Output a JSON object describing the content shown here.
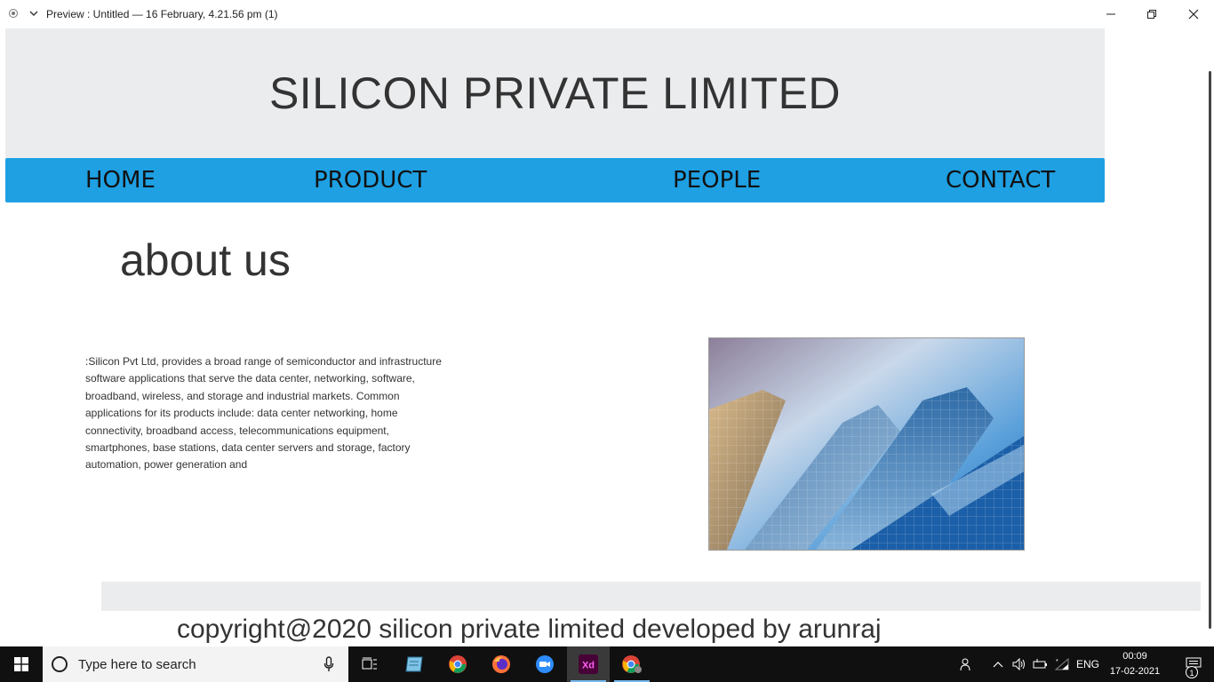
{
  "window": {
    "title": "Preview : Untitled — 16 February, 4.21.56 pm (1)"
  },
  "site": {
    "title": "SILICON PRIVATE LIMITED",
    "nav": [
      "HOME",
      "PRODUCT",
      "PEOPLE",
      "CONTACT"
    ],
    "about_heading": "about us",
    "about_text": ":Silicon Pvt Ltd, provides a broad range of semiconductor and infrastructure software applications that serve the data center, networking, software, broadband, wireless, and storage and industrial markets. Common applications for its products include: data center networking, home connectivity, broadband access, telecommunications equipment, smartphones, base stations, data center servers and storage, factory automation, power generation and",
    "copyright": "copyright@2020 silicon private limited developed by arunraj"
  },
  "taskbar": {
    "search_placeholder": "Type here to search",
    "language": "ENG",
    "time": "00:09",
    "date": "17-02-2021",
    "notification_count": "1"
  },
  "colors": {
    "nav_bar": "#1ea0e3",
    "header_bg": "#ebecee",
    "taskbar_bg": "#101010"
  },
  "icons": [
    "app-icon",
    "chevron-down-icon",
    "minimize-icon",
    "maximize-icon",
    "close-icon",
    "windows-start-icon",
    "search-icon",
    "microphone-icon",
    "task-view-icon",
    "notepad-icon",
    "chrome-icon",
    "firefox-icon",
    "zoom-icon",
    "adobe-xd-icon",
    "chrome-profile-icon",
    "people-icon",
    "chevron-up-icon",
    "speaker-icon",
    "battery-icon",
    "wifi-icon",
    "notification-icon"
  ]
}
